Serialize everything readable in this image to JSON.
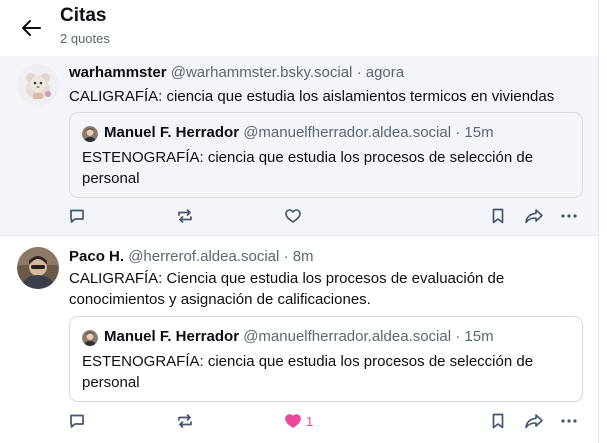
{
  "header": {
    "title": "Citas",
    "subtitle": "2 quotes"
  },
  "posts": [
    {
      "author": "warhammster",
      "handle": "@warhammster.bsky.social",
      "separator": "·",
      "time": "agora",
      "text": "CALIGRAFÍA: ciencia que estudia los aislamientos termicos en viviendas",
      "quote": {
        "author": "Manuel F. Herrador",
        "handle": "@manuelfherrador.aldea.social",
        "separator": "·",
        "time": "15m",
        "text": "ESTENOGRAFÍA: ciencia que estudia los procesos de selección de personal"
      },
      "liked": false,
      "like_count": ""
    },
    {
      "author": "Paco H.",
      "handle": "@herrerof.aldea.social",
      "separator": "·",
      "time": "8m",
      "text": "CALIGRAFÍA: Ciencia que estudia los procesos de evaluación de conocimientos y asignación de calificaciones.",
      "quote": {
        "author": "Manuel F. Herrador",
        "handle": "@manuelfherrador.aldea.social",
        "separator": "·",
        "time": "15m",
        "text": "ESTENOGRAFÍA: ciencia que estudia los procesos de selección de personal"
      },
      "liked": true,
      "like_count": "1"
    }
  ],
  "icons": {
    "back": "arrow-left-icon",
    "reply": "reply-icon",
    "repost": "repost-icon",
    "like": "heart-icon",
    "bookmark": "bookmark-icon",
    "share": "share-icon",
    "more": "more-icon"
  },
  "colors": {
    "accent": "#1083fe",
    "like": "#ec4899",
    "muted": "#5b6773",
    "icon": "#42576c",
    "highlight_bg": "#f3f5f8",
    "border": "#e3e7ec"
  }
}
